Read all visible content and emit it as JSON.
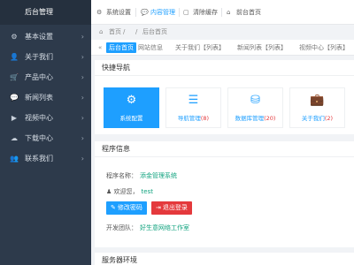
{
  "sidebar": {
    "brand": "后台管理",
    "items": [
      {
        "icon": "⚙",
        "icon_name": "gear-icon",
        "label": "基本设置"
      },
      {
        "icon": "👤",
        "icon_name": "user-icon",
        "label": "关于我们"
      },
      {
        "icon": "🛒",
        "icon_name": "cart-icon",
        "label": "产品中心"
      },
      {
        "icon": "💬",
        "icon_name": "chat-icon",
        "label": "新闻列表"
      },
      {
        "icon": "▶",
        "icon_name": "video-icon",
        "label": "视频中心"
      },
      {
        "icon": "☁",
        "icon_name": "cloud-download-icon",
        "label": "下载中心"
      },
      {
        "icon": "👥",
        "icon_name": "contacts-icon",
        "label": "联系我们"
      }
    ]
  },
  "topbar": {
    "items": [
      {
        "icon": "⚙",
        "label": "系统设置"
      },
      {
        "icon": "💬",
        "label": "内容管理"
      },
      {
        "icon": "▢",
        "label": "清除缓存"
      },
      {
        "icon": "⌂",
        "label": "前台首页"
      }
    ]
  },
  "breadcrumb": {
    "home": "首页",
    "sep1": "/",
    "sep2": "/",
    "current": "后台首页"
  },
  "tabs": [
    "后台首页",
    "网站信息",
    "关于我们【列表】",
    "新闻列表【列表】",
    "视频中心【列表】"
  ],
  "quick_nav": {
    "title": "快捷导航",
    "cards": [
      {
        "icon": "⚙",
        "label": "系统配置",
        "count": ""
      },
      {
        "icon": "☰",
        "label": "导航管理",
        "count": "(8)"
      },
      {
        "icon": "⛁",
        "label": "数据库管理",
        "count": "(20)"
      },
      {
        "icon": "💼",
        "label": "关于我们",
        "count": "(2)"
      }
    ]
  },
  "program_info": {
    "title": "程序信息",
    "name_label": "程序名称：",
    "name_value": "添金管理系统",
    "welcome_label": "欢迎您，",
    "welcome_user": "test",
    "btn_change_pwd": "修改密码",
    "btn_logout": "退出登录",
    "team_label": "开发团队：",
    "team_value": "好生意网络工作室"
  },
  "server_env": {
    "title": "服务器环境"
  },
  "colors": {
    "accent": "#1e9fff",
    "danger": "#e4393c",
    "sidebar_bg": "#2d3a4b"
  }
}
